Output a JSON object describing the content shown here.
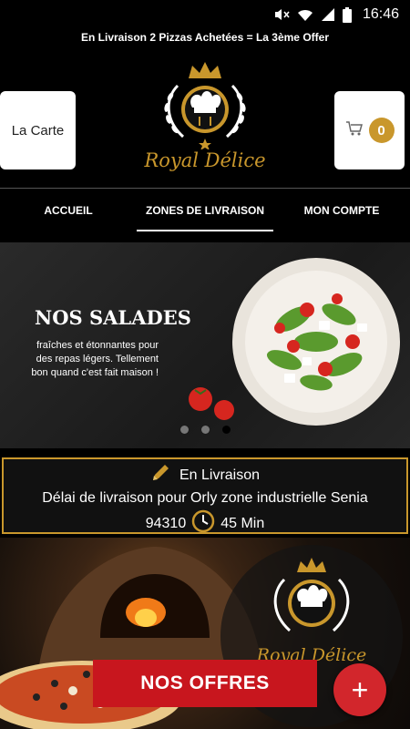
{
  "status_bar": {
    "time": "16:46"
  },
  "marquee": {
    "text": "En Livraison 2 Pizzas Achetées = La 3ème Offer"
  },
  "header": {
    "carte_label": "La Carte",
    "cart_count": "0",
    "logo_text": "Royal Délice"
  },
  "nav": {
    "items": [
      {
        "label": "ACCUEIL"
      },
      {
        "label": "ZONES DE LIVRAISON"
      },
      {
        "label": "MON COMPTE"
      }
    ],
    "active_index": 1
  },
  "banner": {
    "title": "NOS SALADES",
    "subtitle": "fraîches et étonnantes pour des repas légers. Tellement bon quand c'est fait maison !",
    "slides": 3,
    "active_slide": 3
  },
  "delivery": {
    "mode": "En Livraison",
    "delay_text": "Délai de livraison pour Orly zone industrielle Senia",
    "postcode": "94310",
    "duration": "45 Min"
  },
  "hero": {
    "logo_text": "Royal Délice"
  },
  "offers_button": {
    "label": "NOS OFFRES"
  },
  "colors": {
    "gold": "#c9972c",
    "red": "#c8161e",
    "background": "#000000"
  },
  "icons": [
    "mute-icon",
    "wifi-icon",
    "signal-icon",
    "battery-icon",
    "cart-icon",
    "pencil-icon",
    "clock-icon",
    "plus-icon"
  ]
}
